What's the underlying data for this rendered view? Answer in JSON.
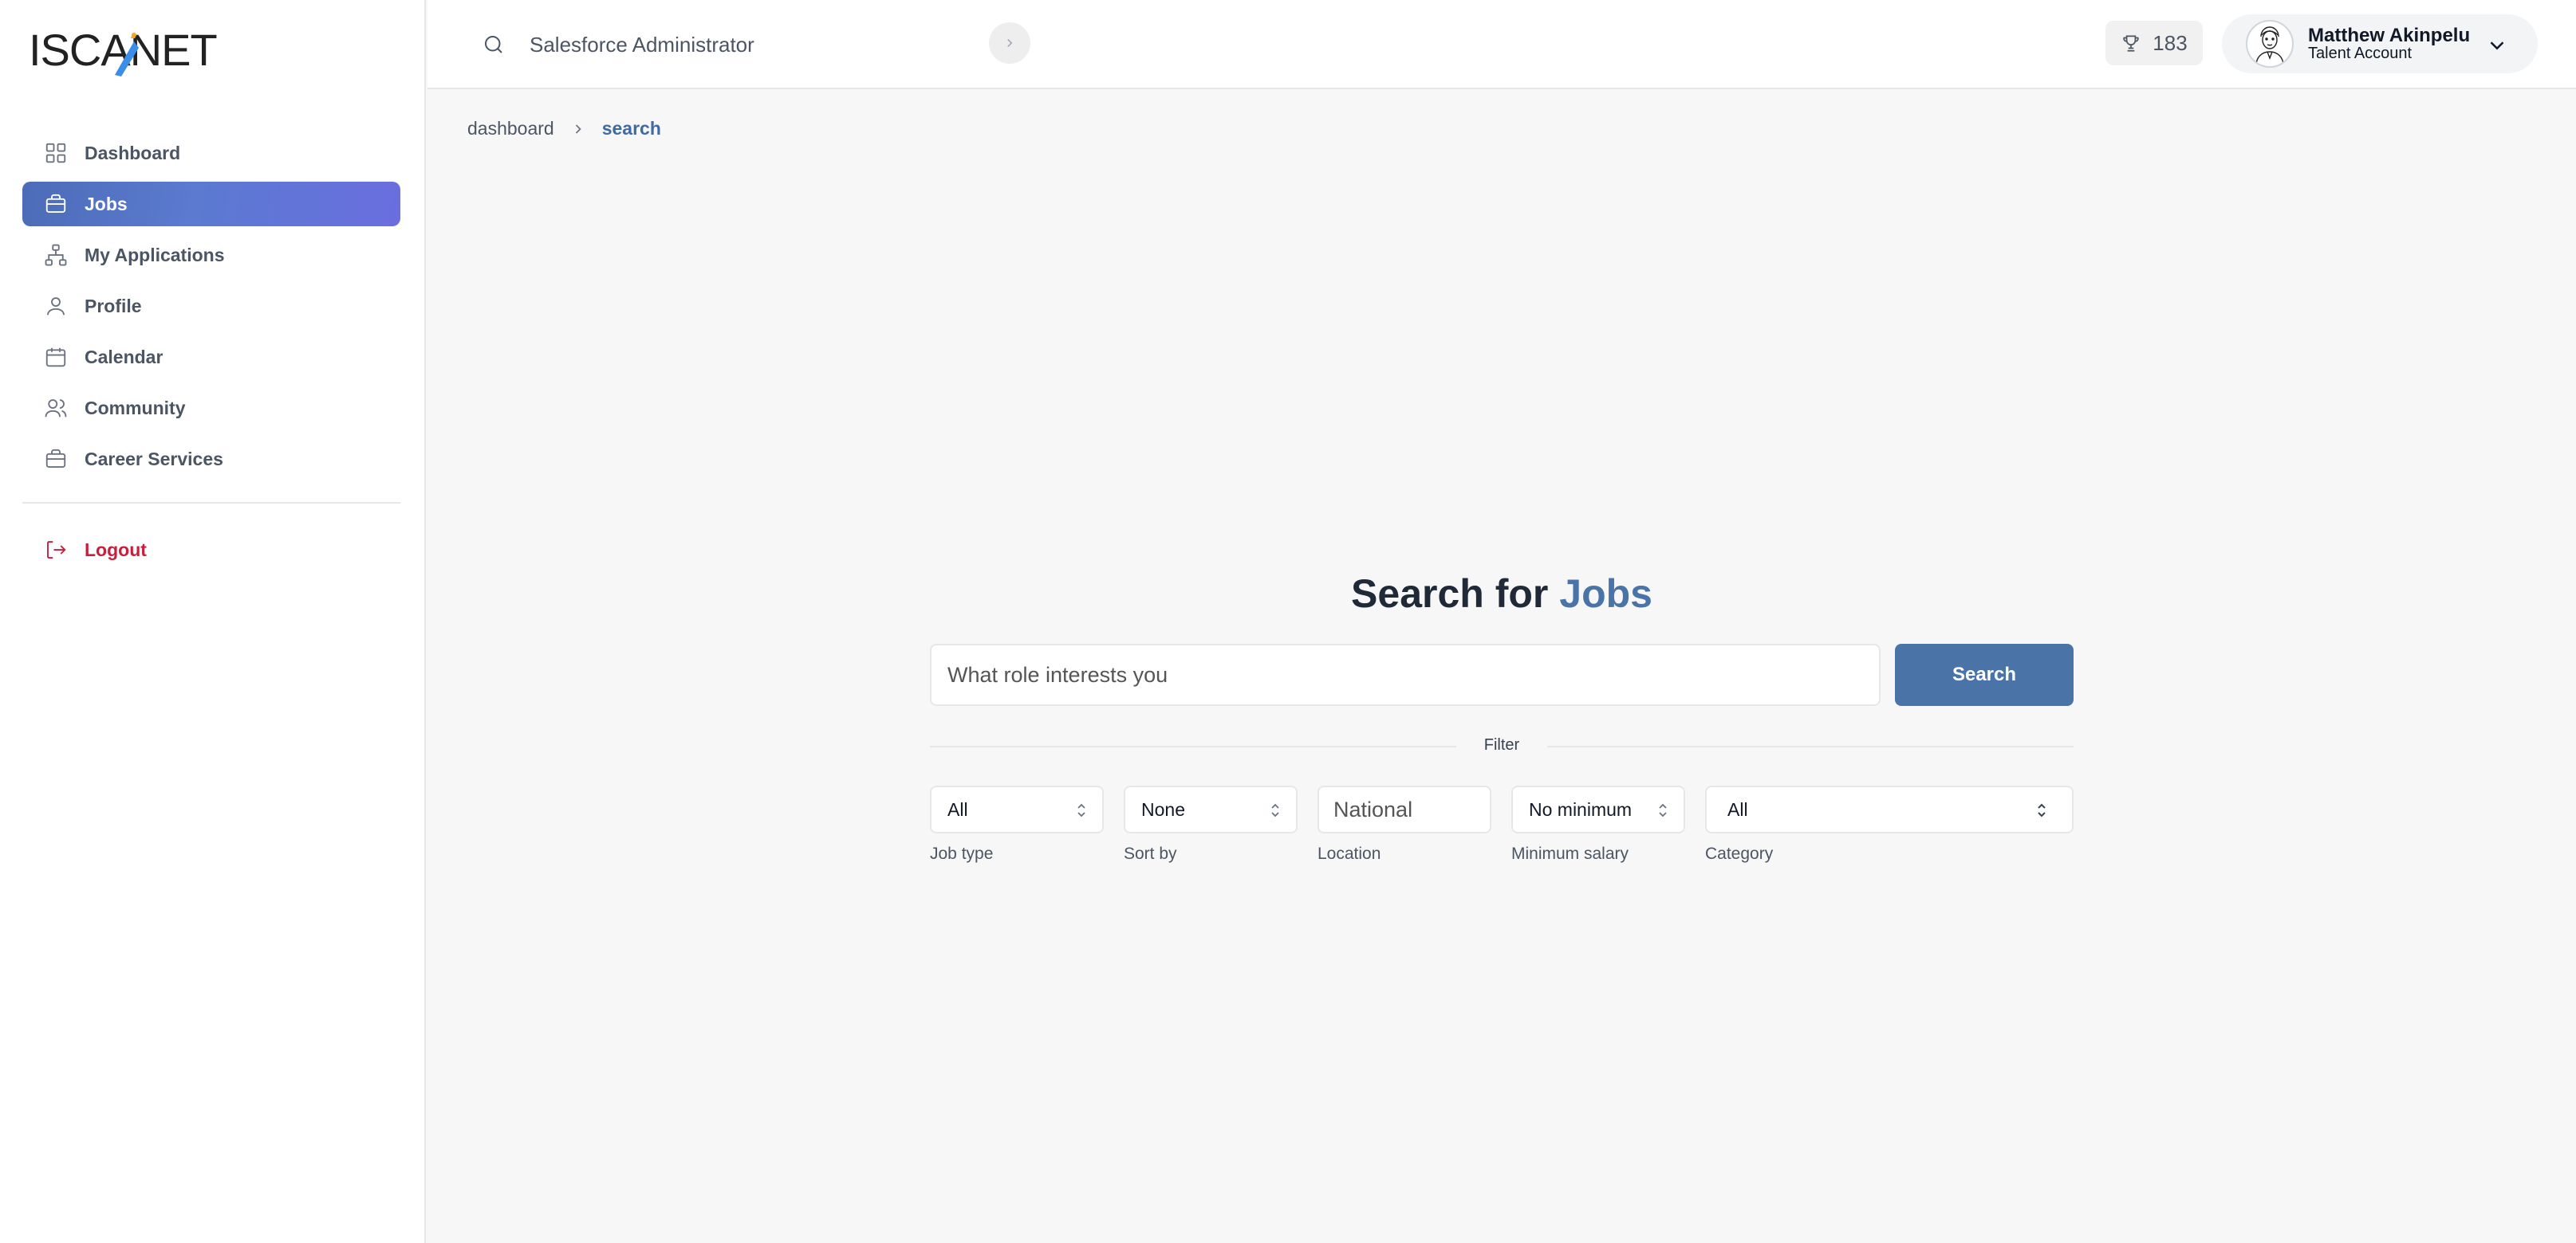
{
  "brand": {
    "logo_text": "ISCANET"
  },
  "sidebar": {
    "items": [
      {
        "label": "Dashboard",
        "icon": "grid-icon"
      },
      {
        "label": "Jobs",
        "icon": "briefcase-icon",
        "active": true
      },
      {
        "label": "My Applications",
        "icon": "sitemap-icon"
      },
      {
        "label": "Profile",
        "icon": "user-icon"
      },
      {
        "label": "Calendar",
        "icon": "calendar-icon"
      },
      {
        "label": "Community",
        "icon": "users-icon"
      },
      {
        "label": "Career Services",
        "icon": "briefcase-icon"
      }
    ],
    "logout_label": "Logout"
  },
  "topbar": {
    "search_value": "Salesforce Administrator",
    "points": "183",
    "user_name": "Matthew Akinpelu",
    "user_role": "Talent Account"
  },
  "breadcrumb": [
    "dashboard",
    "search"
  ],
  "main": {
    "headline_prefix": "Search for",
    "headline_accent": "Jobs",
    "search_placeholder": "What role interests you",
    "search_button": "Search",
    "filter_label": "Filter",
    "filters": {
      "job_type": {
        "value": "All",
        "label": "Job type"
      },
      "sort_by": {
        "value": "None",
        "label": "Sort by"
      },
      "location": {
        "placeholder": "National",
        "label": "Location"
      },
      "min_salary": {
        "value": "No minimum",
        "label": "Minimum salary"
      },
      "category": {
        "value": "All",
        "label": "Category"
      }
    }
  },
  "colors": {
    "accent": "#4a73a8",
    "active_nav_start": "#4c6cb8",
    "active_nav_end": "#6a6ee0",
    "logout": "#c81e3c"
  }
}
